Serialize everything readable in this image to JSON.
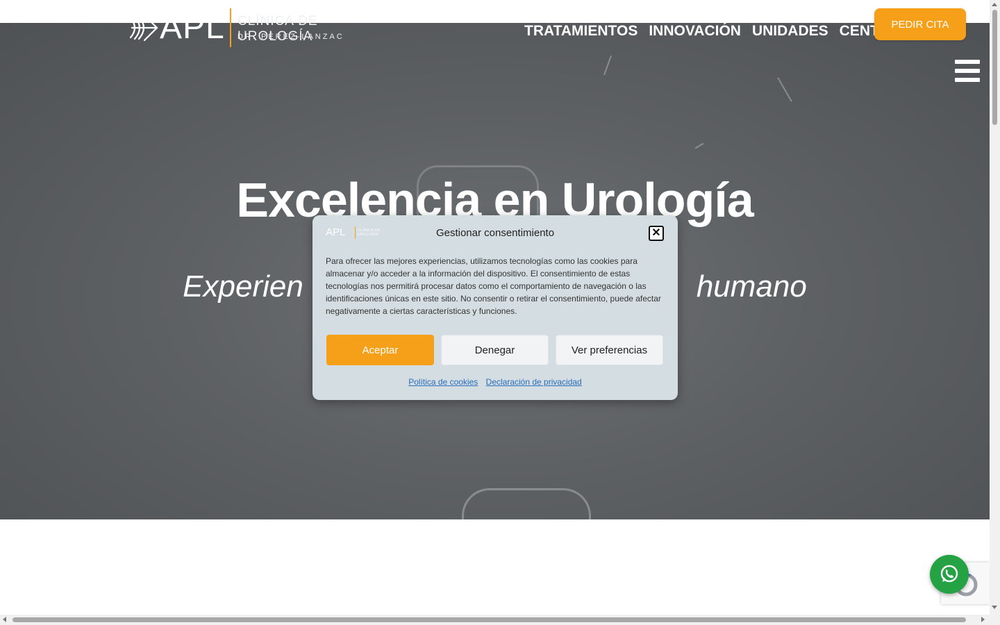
{
  "header": {
    "logo": {
      "brand": "APL",
      "line1": "CLÍNICA DE UROLOGÍA",
      "line2": "DR. PÉREZ-LANZAC"
    },
    "nav": [
      "TRATAMIENTOS",
      "INNOVACIÓN",
      "UNIDADES",
      "CENTROS"
    ],
    "cta_label": "PEDIR CITA",
    "menu_icon": "hamburger-icon"
  },
  "hero": {
    "title": "Excelencia en Urología",
    "subtitle_left": "Experien",
    "subtitle_right": "humano"
  },
  "consent": {
    "title": "Gestionar consentimiento",
    "body": "Para ofrecer las mejores experiencias, utilizamos tecnologías como las cookies para almacenar y/o acceder a la información del dispositivo. El consentimiento de estas tecnologías nos permitirá procesar datos como el comportamiento de navegación o las identificaciones únicas en este sitio. No consentir o retirar el consentimiento, puede afectar negativamente a ciertas características y funciones.",
    "accept": "Aceptar",
    "deny": "Denegar",
    "preferences": "Ver preferencias",
    "cookies_link": "Política de cookies",
    "privacy_link": "Declaración de privacidad",
    "close_icon": "close-icon"
  },
  "floating": {
    "whatsapp_icon": "whatsapp-icon",
    "recaptcha_icon": "recaptcha-icon"
  },
  "colors": {
    "accent": "#f6a01a",
    "modal_bg": "#d4dde1",
    "whatsapp": "#25a244",
    "link": "#2a6ebd"
  }
}
